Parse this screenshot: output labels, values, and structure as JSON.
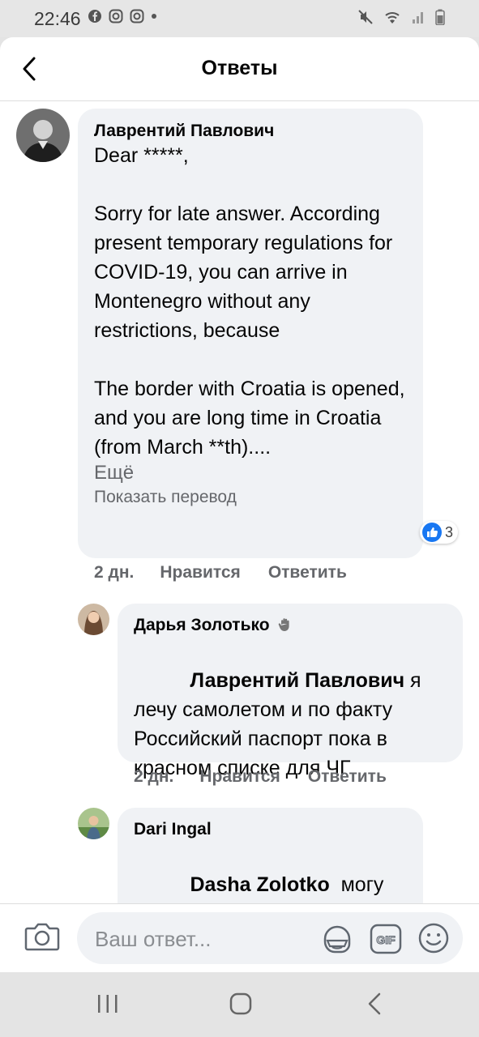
{
  "status_bar": {
    "time": "22:46"
  },
  "header": {
    "title": "Ответы"
  },
  "comments": [
    {
      "author": "Лаврентий Павлович",
      "text": "Dear *****,\n\nSorry for late answer. According present temporary regulations for COVID-19, you can arrive in Montenegro without any restrictions, because\n\nThe border with Croatia is opened, and you are long time in Croatia (from March **th)....",
      "more": "Ещё",
      "translate": "Показать перевод",
      "time": "2 дн.",
      "like": "Нравится",
      "reply": "Ответить",
      "reactions": "3"
    },
    {
      "author": "Дарья Золотько",
      "mention": "Лаврентий Павлович",
      "text": " я лечу самолетом и по факту Российский паспорт пока в красном списке для ЧГ",
      "time": "2 дн.",
      "like": "Нравится",
      "reply": "Ответить"
    },
    {
      "author": "Dari Ingal",
      "mention": "Dasha Zolotko",
      "text": "  могу предложить свою"
    }
  ],
  "composer": {
    "placeholder": "Ваш ответ..."
  },
  "icons": [
    "back-arrow-icon",
    "camera-icon",
    "sticker-icon",
    "gif-icon",
    "emoji-icon",
    "like-icon",
    "wave-icon",
    "recents-icon",
    "home-icon",
    "back-icon"
  ],
  "colors": {
    "accent": "#1877f2",
    "bubble": "#f0f2f5",
    "muted": "#65676b"
  }
}
